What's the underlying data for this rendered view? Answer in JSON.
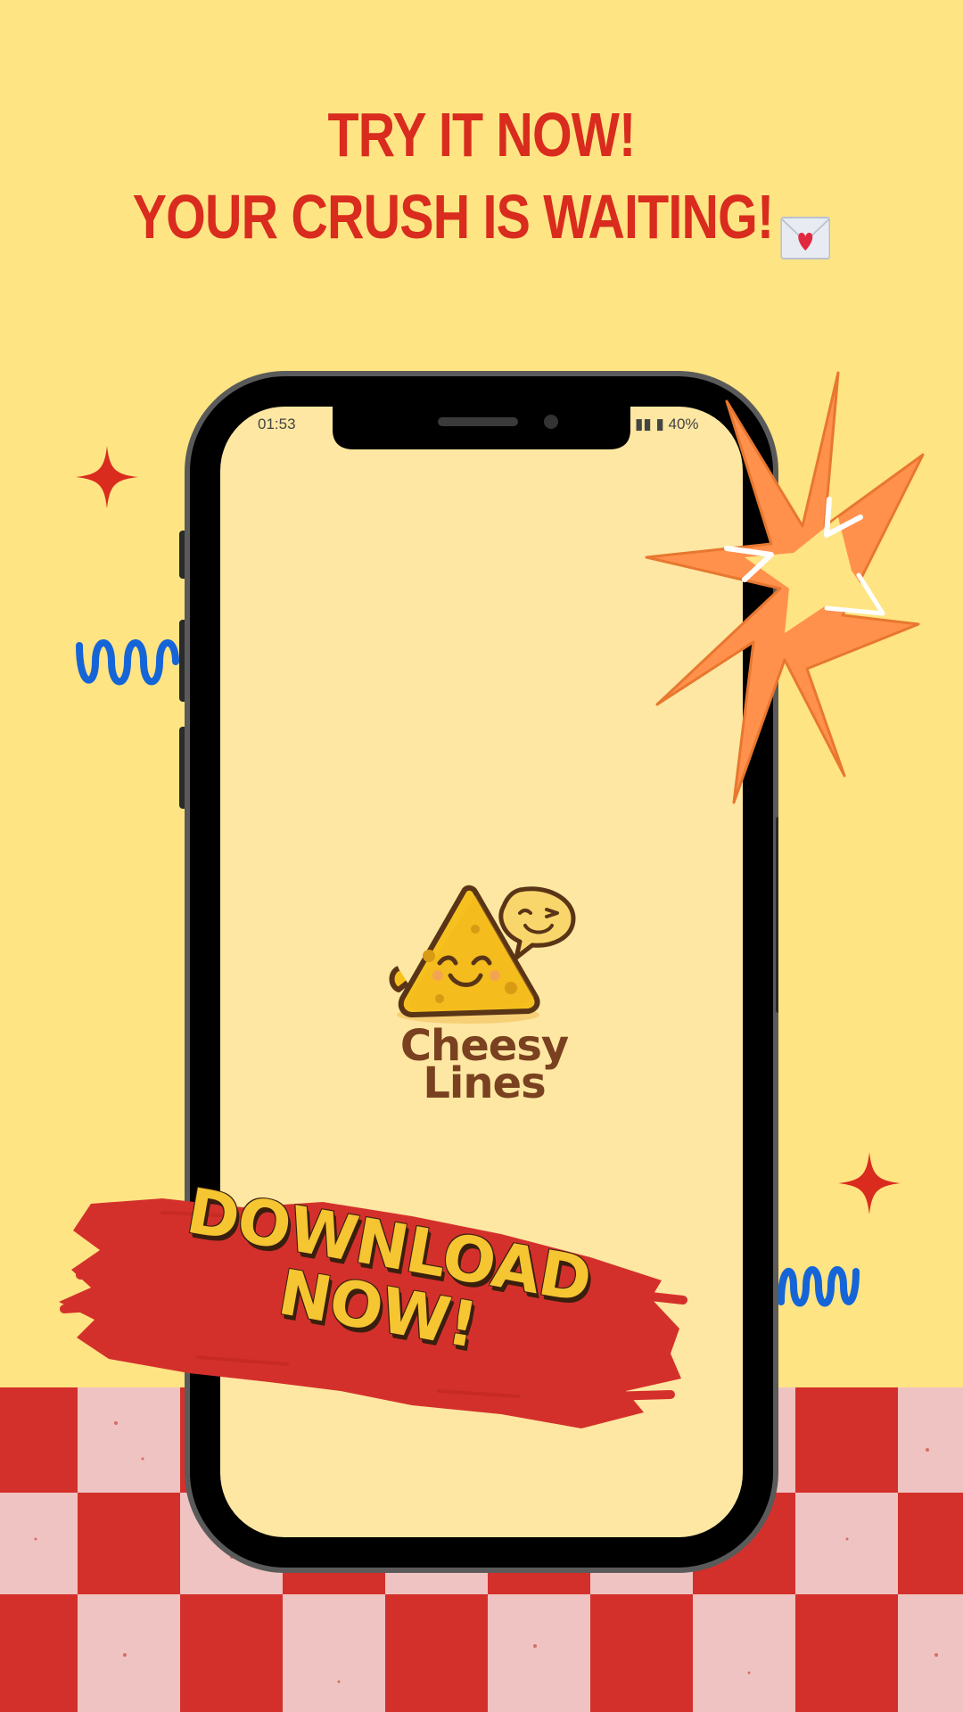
{
  "headline": {
    "line1": "TRY IT NOW!",
    "line2": "YOUR CRUSH IS WAITING!",
    "emoji": "love-letter-icon"
  },
  "phone": {
    "status_time": "01:53",
    "status_battery": "40%",
    "screen_color": "#fde7a2"
  },
  "app": {
    "name_line1": "Cheesy",
    "name_line2": "Lines"
  },
  "banner": {
    "line1": "DOWNLOAD",
    "line2": "NOW!"
  },
  "colors": {
    "background": "#fee483",
    "accent_red": "#d92b1e",
    "banner_red": "#d4302b",
    "check_pink": "#efc3c1",
    "starburst_orange": "#ff914d",
    "squiggle_blue": "#1565d8",
    "brand_brown": "#7a4120"
  }
}
